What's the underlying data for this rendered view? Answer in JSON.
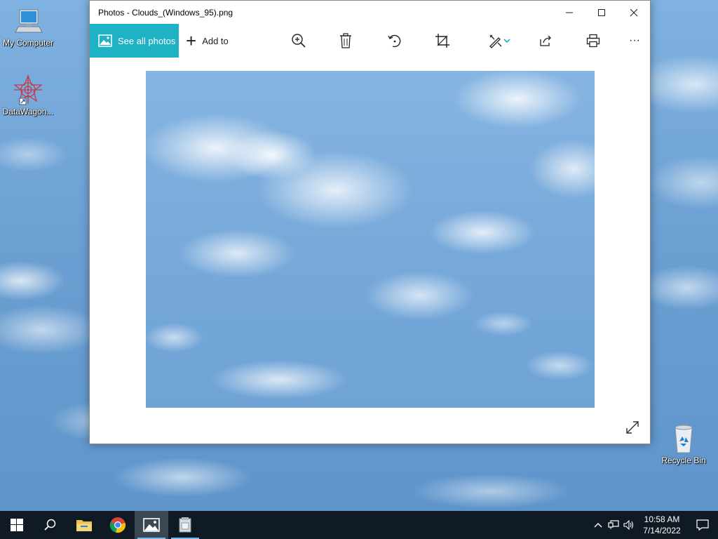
{
  "desktop": {
    "icons": [
      {
        "label": "My Computer"
      },
      {
        "label": "DataWagon..."
      },
      {
        "label": "Recycle Bin"
      }
    ]
  },
  "window": {
    "title": "Photos - Clouds_(Windows_95).png",
    "toolbar": {
      "see_all_label": "See all photos",
      "add_to_label": "Add to",
      "more_label": "···"
    },
    "accent_color": "#1fb2c4"
  },
  "taskbar": {
    "time": "10:58 AM",
    "date": "7/14/2022"
  }
}
